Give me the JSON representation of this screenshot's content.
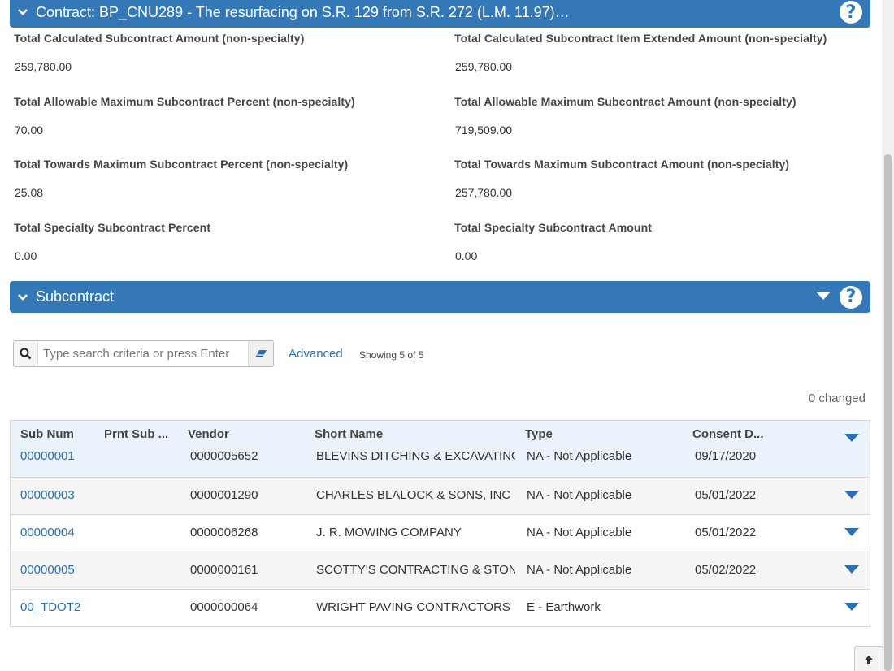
{
  "contract_panel": {
    "title": "Contract: BP_CNU289 - The resurfacing on S.R. 129 from S.R. 272 (L.M. 11.97)…"
  },
  "summary": {
    "total_calc_amount_label": "Total Calculated Subcontract Amount (non-specialty)",
    "total_calc_amount_value": "259,780.00",
    "total_calc_item_label": "Total Calculated Subcontract Item Extended Amount (non-specialty)",
    "total_calc_item_value": "259,780.00",
    "max_percent_label": "Total Allowable Maximum Subcontract Percent (non-specialty)",
    "max_percent_value": "70.00",
    "max_amount_label": "Total Allowable Maximum Subcontract Amount (non-specialty)",
    "max_amount_value": "719,509.00",
    "towards_percent_label": "Total Towards Maximum Subcontract Percent (non-specialty)",
    "towards_percent_value": "25.08",
    "towards_amount_label": "Total Towards Maximum Subcontract Amount (non-specialty)",
    "towards_amount_value": "257,780.00",
    "specialty_percent_label": "Total Specialty Subcontract Percent",
    "specialty_percent_value": "0.00",
    "specialty_amount_label": "Total Specialty Subcontract Amount",
    "specialty_amount_value": "0.00"
  },
  "subcontract_panel": {
    "title": "Subcontract"
  },
  "toolbar": {
    "search_placeholder": "Type search criteria or press Enter",
    "advanced_label": "Advanced",
    "showing_text": "Showing 5 of 5",
    "changed_text": "0 changed"
  },
  "grid": {
    "columns": [
      "Sub Num",
      "Prnt Sub ...",
      "Vendor",
      "Short Name",
      "Type",
      "Consent D..."
    ],
    "rows": [
      {
        "sub_num": "00000001",
        "prnt_sub": "",
        "vendor": "0000005652",
        "short_name": "BLEVINS DITCHING & EXCAVATING",
        "type": "NA - Not Applicable",
        "consent_date": "09/17/2020"
      },
      {
        "sub_num": "00000003",
        "prnt_sub": "",
        "vendor": "0000001290",
        "short_name": "CHARLES BLALOCK & SONS, INC",
        "type": "NA - Not Applicable",
        "consent_date": "05/01/2022"
      },
      {
        "sub_num": "00000004",
        "prnt_sub": "",
        "vendor": "0000006268",
        "short_name": "J. R. MOWING COMPANY",
        "type": "NA - Not Applicable",
        "consent_date": "05/01/2022"
      },
      {
        "sub_num": "00000005",
        "prnt_sub": "",
        "vendor": "0000000161",
        "short_name": "SCOTTY'S CONTRACTING & STONE",
        "type": "NA - Not Applicable",
        "consent_date": "05/02/2022"
      },
      {
        "sub_num": "00_TDOT2",
        "prnt_sub": "",
        "vendor": "0000000064",
        "short_name": "WRIGHT PAVING CONTRACTORS",
        "type": "E - Earthwork",
        "consent_date": ""
      }
    ]
  },
  "colors": {
    "header_blue": "#3478b8",
    "link_blue": "#2a6fb0",
    "selected_row": "#eaf2fb"
  }
}
